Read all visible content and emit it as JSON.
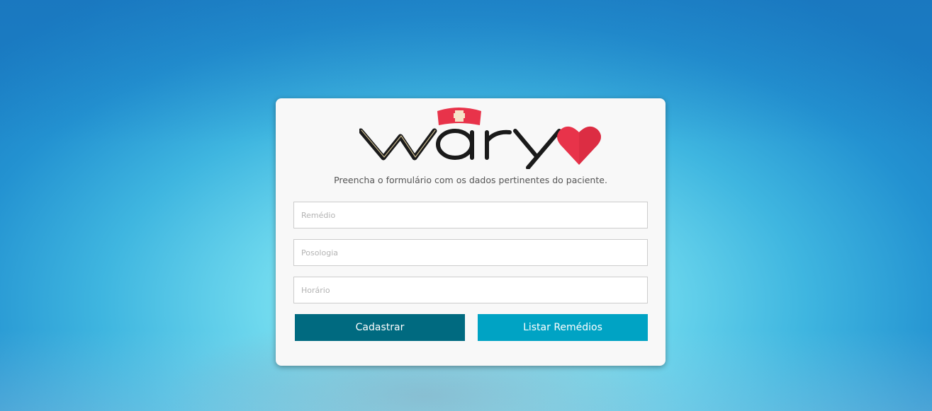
{
  "brand": {
    "name": "wary",
    "colors": {
      "wordmark": "#1a1a1a",
      "heart": "#e8334a",
      "cap": "#e8334a",
      "cross": "#f6e3c8"
    }
  },
  "form": {
    "subtitle": "Preencha o formulário com os dados pertinentes do paciente.",
    "fields": [
      {
        "name": "remedio",
        "placeholder": "Remédio",
        "value": ""
      },
      {
        "name": "posologia",
        "placeholder": "Posologia",
        "value": ""
      },
      {
        "name": "horario",
        "placeholder": "Horário",
        "value": ""
      }
    ],
    "buttons": {
      "submit_label": "Cadastrar",
      "list_label": "Listar Remédios"
    }
  },
  "colors": {
    "primary_button": "#006a80",
    "secondary_button": "#00a3c4",
    "card_background": "#f8f8f8"
  }
}
